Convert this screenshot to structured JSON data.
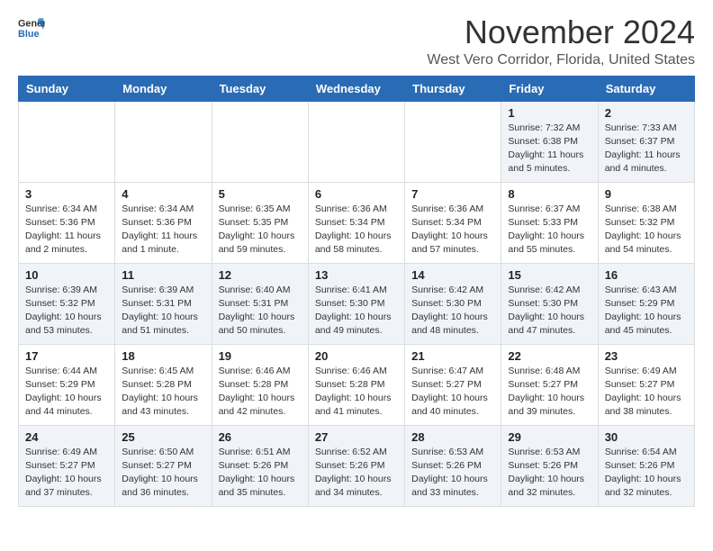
{
  "header": {
    "logo_line1": "General",
    "logo_line2": "Blue",
    "month": "November 2024",
    "location": "West Vero Corridor, Florida, United States"
  },
  "days_of_week": [
    "Sunday",
    "Monday",
    "Tuesday",
    "Wednesday",
    "Thursday",
    "Friday",
    "Saturday"
  ],
  "weeks": [
    [
      {
        "day": "",
        "info": ""
      },
      {
        "day": "",
        "info": ""
      },
      {
        "day": "",
        "info": ""
      },
      {
        "day": "",
        "info": ""
      },
      {
        "day": "",
        "info": ""
      },
      {
        "day": "1",
        "info": "Sunrise: 7:32 AM\nSunset: 6:38 PM\nDaylight: 11 hours\nand 5 minutes."
      },
      {
        "day": "2",
        "info": "Sunrise: 7:33 AM\nSunset: 6:37 PM\nDaylight: 11 hours\nand 4 minutes."
      }
    ],
    [
      {
        "day": "3",
        "info": "Sunrise: 6:34 AM\nSunset: 5:36 PM\nDaylight: 11 hours\nand 2 minutes."
      },
      {
        "day": "4",
        "info": "Sunrise: 6:34 AM\nSunset: 5:36 PM\nDaylight: 11 hours\nand 1 minute."
      },
      {
        "day": "5",
        "info": "Sunrise: 6:35 AM\nSunset: 5:35 PM\nDaylight: 10 hours\nand 59 minutes."
      },
      {
        "day": "6",
        "info": "Sunrise: 6:36 AM\nSunset: 5:34 PM\nDaylight: 10 hours\nand 58 minutes."
      },
      {
        "day": "7",
        "info": "Sunrise: 6:36 AM\nSunset: 5:34 PM\nDaylight: 10 hours\nand 57 minutes."
      },
      {
        "day": "8",
        "info": "Sunrise: 6:37 AM\nSunset: 5:33 PM\nDaylight: 10 hours\nand 55 minutes."
      },
      {
        "day": "9",
        "info": "Sunrise: 6:38 AM\nSunset: 5:32 PM\nDaylight: 10 hours\nand 54 minutes."
      }
    ],
    [
      {
        "day": "10",
        "info": "Sunrise: 6:39 AM\nSunset: 5:32 PM\nDaylight: 10 hours\nand 53 minutes."
      },
      {
        "day": "11",
        "info": "Sunrise: 6:39 AM\nSunset: 5:31 PM\nDaylight: 10 hours\nand 51 minutes."
      },
      {
        "day": "12",
        "info": "Sunrise: 6:40 AM\nSunset: 5:31 PM\nDaylight: 10 hours\nand 50 minutes."
      },
      {
        "day": "13",
        "info": "Sunrise: 6:41 AM\nSunset: 5:30 PM\nDaylight: 10 hours\nand 49 minutes."
      },
      {
        "day": "14",
        "info": "Sunrise: 6:42 AM\nSunset: 5:30 PM\nDaylight: 10 hours\nand 48 minutes."
      },
      {
        "day": "15",
        "info": "Sunrise: 6:42 AM\nSunset: 5:30 PM\nDaylight: 10 hours\nand 47 minutes."
      },
      {
        "day": "16",
        "info": "Sunrise: 6:43 AM\nSunset: 5:29 PM\nDaylight: 10 hours\nand 45 minutes."
      }
    ],
    [
      {
        "day": "17",
        "info": "Sunrise: 6:44 AM\nSunset: 5:29 PM\nDaylight: 10 hours\nand 44 minutes."
      },
      {
        "day": "18",
        "info": "Sunrise: 6:45 AM\nSunset: 5:28 PM\nDaylight: 10 hours\nand 43 minutes."
      },
      {
        "day": "19",
        "info": "Sunrise: 6:46 AM\nSunset: 5:28 PM\nDaylight: 10 hours\nand 42 minutes."
      },
      {
        "day": "20",
        "info": "Sunrise: 6:46 AM\nSunset: 5:28 PM\nDaylight: 10 hours\nand 41 minutes."
      },
      {
        "day": "21",
        "info": "Sunrise: 6:47 AM\nSunset: 5:27 PM\nDaylight: 10 hours\nand 40 minutes."
      },
      {
        "day": "22",
        "info": "Sunrise: 6:48 AM\nSunset: 5:27 PM\nDaylight: 10 hours\nand 39 minutes."
      },
      {
        "day": "23",
        "info": "Sunrise: 6:49 AM\nSunset: 5:27 PM\nDaylight: 10 hours\nand 38 minutes."
      }
    ],
    [
      {
        "day": "24",
        "info": "Sunrise: 6:49 AM\nSunset: 5:27 PM\nDaylight: 10 hours\nand 37 minutes."
      },
      {
        "day": "25",
        "info": "Sunrise: 6:50 AM\nSunset: 5:27 PM\nDaylight: 10 hours\nand 36 minutes."
      },
      {
        "day": "26",
        "info": "Sunrise: 6:51 AM\nSunset: 5:26 PM\nDaylight: 10 hours\nand 35 minutes."
      },
      {
        "day": "27",
        "info": "Sunrise: 6:52 AM\nSunset: 5:26 PM\nDaylight: 10 hours\nand 34 minutes."
      },
      {
        "day": "28",
        "info": "Sunrise: 6:53 AM\nSunset: 5:26 PM\nDaylight: 10 hours\nand 33 minutes."
      },
      {
        "day": "29",
        "info": "Sunrise: 6:53 AM\nSunset: 5:26 PM\nDaylight: 10 hours\nand 32 minutes."
      },
      {
        "day": "30",
        "info": "Sunrise: 6:54 AM\nSunset: 5:26 PM\nDaylight: 10 hours\nand 32 minutes."
      }
    ]
  ]
}
